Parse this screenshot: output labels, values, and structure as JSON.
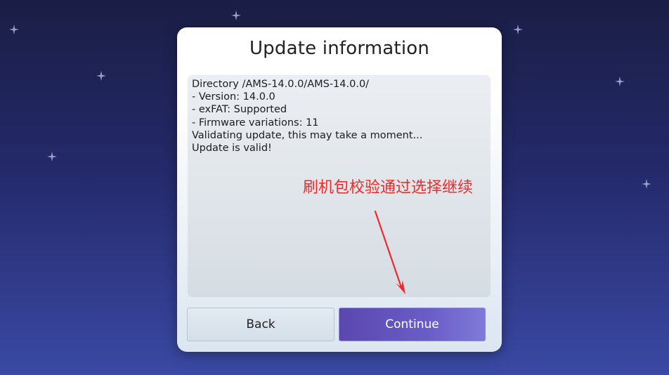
{
  "dialog": {
    "title": "Update information",
    "log_lines": [
      "Directory /AMS-14.0.0/AMS-14.0.0/",
      "- Version: 14.0.0",
      "- exFAT: Supported",
      "- Firmware variations: 11",
      "Validating update, this may take a moment...",
      "Update is valid!"
    ],
    "annotation": "刷机包校验通过选择继续",
    "buttons": {
      "back_label": "Back",
      "continue_label": "Continue"
    }
  },
  "colors": {
    "annotation": "#ee2a2a",
    "continue_button": "#6a5cc7",
    "background_top": "#1a1e45",
    "background_bottom": "#3a49a4"
  },
  "icons": [
    "sparkle-star-icon",
    "arrow-annotation-icon"
  ]
}
